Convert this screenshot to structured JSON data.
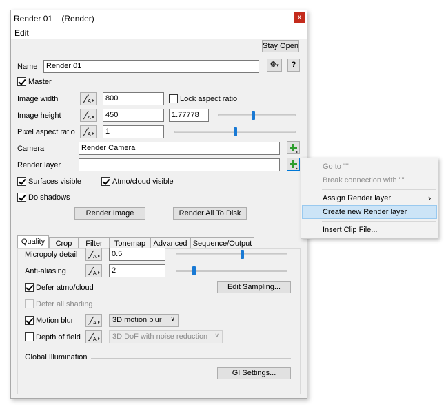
{
  "window": {
    "title": "Render 01",
    "title_type": "(Render)",
    "close_glyph": "x",
    "menu": [
      "Edit"
    ],
    "stay_open": "Stay Open"
  },
  "fields": {
    "name_label": "Name",
    "name_value": "Render 01",
    "settings_glyph": "⚙",
    "help_glyph": "?",
    "master_label": "Master",
    "master_checked": true,
    "image_width_label": "Image width",
    "image_width_value": "800",
    "lock_aspect_label": "Lock aspect ratio",
    "lock_aspect_checked": false,
    "image_height_label": "Image height",
    "image_height_value": "450",
    "aspect_value": "1.77778",
    "pixel_aspect_label": "Pixel aspect ratio",
    "pixel_aspect_value": "1",
    "camera_label": "Camera",
    "camera_value": "Render Camera",
    "render_layer_label": "Render layer",
    "render_layer_value": "",
    "surfaces_visible_label": "Surfaces visible",
    "surfaces_visible_checked": true,
    "atmo_visible_label": "Atmo/cloud visible",
    "atmo_visible_checked": true,
    "do_shadows_label": "Do shadows",
    "do_shadows_checked": true,
    "render_image_btn": "Render Image",
    "render_all_btn": "Render All To Disk"
  },
  "tabs": [
    "Quality",
    "Crop",
    "Filter",
    "Tonemap",
    "Advanced",
    "Sequence/Output"
  ],
  "active_tab": "Quality",
  "quality": {
    "micropoly_label": "Micropoly detail",
    "micropoly_value": "0.5",
    "antialias_label": "Anti-aliasing",
    "antialias_value": "2",
    "defer_atmo_label": "Defer atmo/cloud",
    "defer_atmo_checked": true,
    "edit_sampling_btn": "Edit Sampling...",
    "defer_all_label": "Defer all shading",
    "defer_all_checked": false,
    "motion_blur_label": "Motion blur",
    "motion_blur_checked": true,
    "motion_blur_option": "3D motion blur",
    "dof_label": "Depth of field",
    "dof_checked": false,
    "dof_option": "3D DoF with noise reduction",
    "gi_label": "Global Illumination",
    "gi_settings_btn": "GI Settings..."
  },
  "sliders": {
    "aspect_level": 0.45,
    "pixel_aspect_level": 0.5,
    "micropoly_level": 0.6,
    "antialias_level": 0.15
  },
  "context_menu": {
    "items": [
      {
        "label": "Go to \"\"",
        "enabled": false
      },
      {
        "label": "Break connection with \"\"",
        "enabled": false
      },
      {
        "label": "Assign Render layer",
        "enabled": true,
        "submenu": true
      },
      {
        "label": "Create new Render layer",
        "enabled": true,
        "highlighted": true
      },
      {
        "label": "Insert Clip File...",
        "enabled": true
      }
    ],
    "submenu_glyph": "›"
  },
  "colors": {
    "accent": "#1979d4",
    "close_button": "#c42b1c",
    "menu_highlight": "#cce4f7",
    "add_icon_green": "#2e9e2e"
  }
}
